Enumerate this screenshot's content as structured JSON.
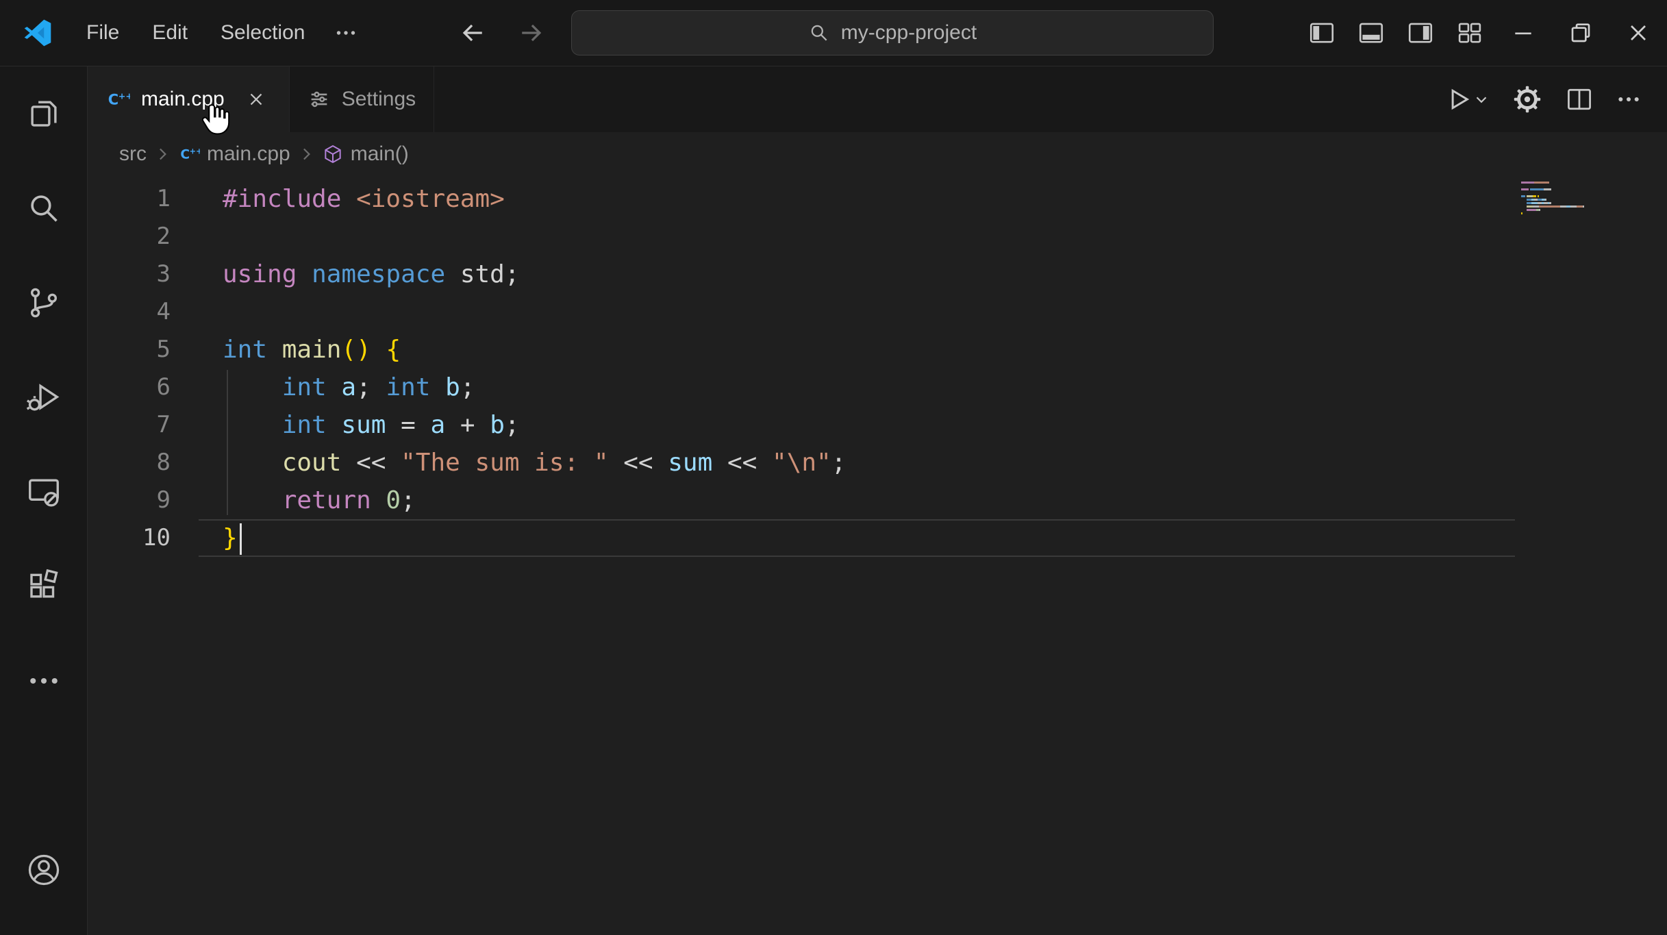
{
  "titlebar": {
    "menus": [
      {
        "label": "File"
      },
      {
        "label": "Edit"
      },
      {
        "label": "Selection"
      }
    ],
    "search_value": "my-cpp-project",
    "right_icons": [
      "toggle-primary-sidebar",
      "toggle-panel",
      "toggle-secondary-sidebar",
      "customize-layout",
      "minimize",
      "maximize",
      "close"
    ]
  },
  "activity_bar": {
    "icons": [
      "explorer-files",
      "search",
      "source-control",
      "run-and-debug",
      "remote-explorer",
      "extensions",
      "more",
      "account"
    ]
  },
  "tab_bar": {
    "tabs": [
      {
        "label": "main.cpp",
        "icon": "cpp-file-icon",
        "active": true
      },
      {
        "label": "Settings",
        "icon": "settings-sliders-icon",
        "active": false
      }
    ],
    "actions": [
      "run-or-debug",
      "settings-gear",
      "split-editor",
      "more-actions"
    ]
  },
  "breadcrumbs": {
    "items": [
      {
        "label": "src",
        "icon": null
      },
      {
        "label": "main.cpp",
        "icon": "cpp-file-icon"
      },
      {
        "label": "main()",
        "icon": "symbol-method-icon"
      }
    ]
  },
  "editor": {
    "language": "cpp",
    "lines": [
      {
        "n": "1",
        "tokens": [
          [
            "#include ",
            "pre"
          ],
          [
            "<iostream>",
            "str"
          ]
        ]
      },
      {
        "n": "2",
        "tokens": []
      },
      {
        "n": "3",
        "tokens": [
          [
            "using",
            "pre"
          ],
          [
            " ",
            "pln"
          ],
          [
            "namespace",
            "kw"
          ],
          [
            " std",
            "pln"
          ],
          [
            ";",
            "pln"
          ]
        ]
      },
      {
        "n": "4",
        "tokens": []
      },
      {
        "n": "5",
        "tokens": [
          [
            "int",
            "kw"
          ],
          [
            " ",
            "pln"
          ],
          [
            "main",
            "fn"
          ],
          [
            "()",
            "br1"
          ],
          [
            " ",
            "pln"
          ],
          [
            "{",
            "br1"
          ]
        ]
      },
      {
        "n": "6",
        "tokens": [
          [
            "    ",
            "pln"
          ],
          [
            "int",
            "kw"
          ],
          [
            " a",
            "var"
          ],
          [
            "; ",
            "pln"
          ],
          [
            "int",
            "kw"
          ],
          [
            " b",
            "var"
          ],
          [
            ";",
            "pln"
          ]
        ]
      },
      {
        "n": "7",
        "tokens": [
          [
            "    ",
            "pln"
          ],
          [
            "int",
            "kw"
          ],
          [
            " sum",
            "var"
          ],
          [
            " = ",
            "pln"
          ],
          [
            "a",
            "var"
          ],
          [
            " + ",
            "pln"
          ],
          [
            "b",
            "var"
          ],
          [
            ";",
            "pln"
          ]
        ]
      },
      {
        "n": "8",
        "tokens": [
          [
            "    ",
            "pln"
          ],
          [
            "cout",
            "fn"
          ],
          [
            " << ",
            "pln"
          ],
          [
            "\"The sum is: \"",
            "str"
          ],
          [
            " << ",
            "pln"
          ],
          [
            "sum",
            "var"
          ],
          [
            " << ",
            "pln"
          ],
          [
            "\"\\n\"",
            "str"
          ],
          [
            ";",
            "pln"
          ]
        ]
      },
      {
        "n": "9",
        "tokens": [
          [
            "    ",
            "pln"
          ],
          [
            "return",
            "pre"
          ],
          [
            " 0",
            "num"
          ],
          [
            ";",
            "pln"
          ]
        ]
      },
      {
        "n": "10",
        "tokens": [
          [
            "}",
            "br1"
          ]
        ],
        "cursor": true,
        "current": true
      }
    ]
  },
  "colors": {
    "titlebar_bg": "#181818",
    "editor_bg": "#1f1f1f",
    "cpp_icon_blue": "#42A5F5",
    "symbol_method_purple": "#B180D7",
    "logo_blue": "#22A7F2",
    "syntax": {
      "pre": "#C586C0",
      "kw": "#569CD6",
      "fn": "#DCDCAA",
      "str": "#CE9178",
      "num": "#B5CEA8",
      "var": "#9CDCFE",
      "pln": "#D4D4D4",
      "br1": "#FFD700"
    }
  }
}
